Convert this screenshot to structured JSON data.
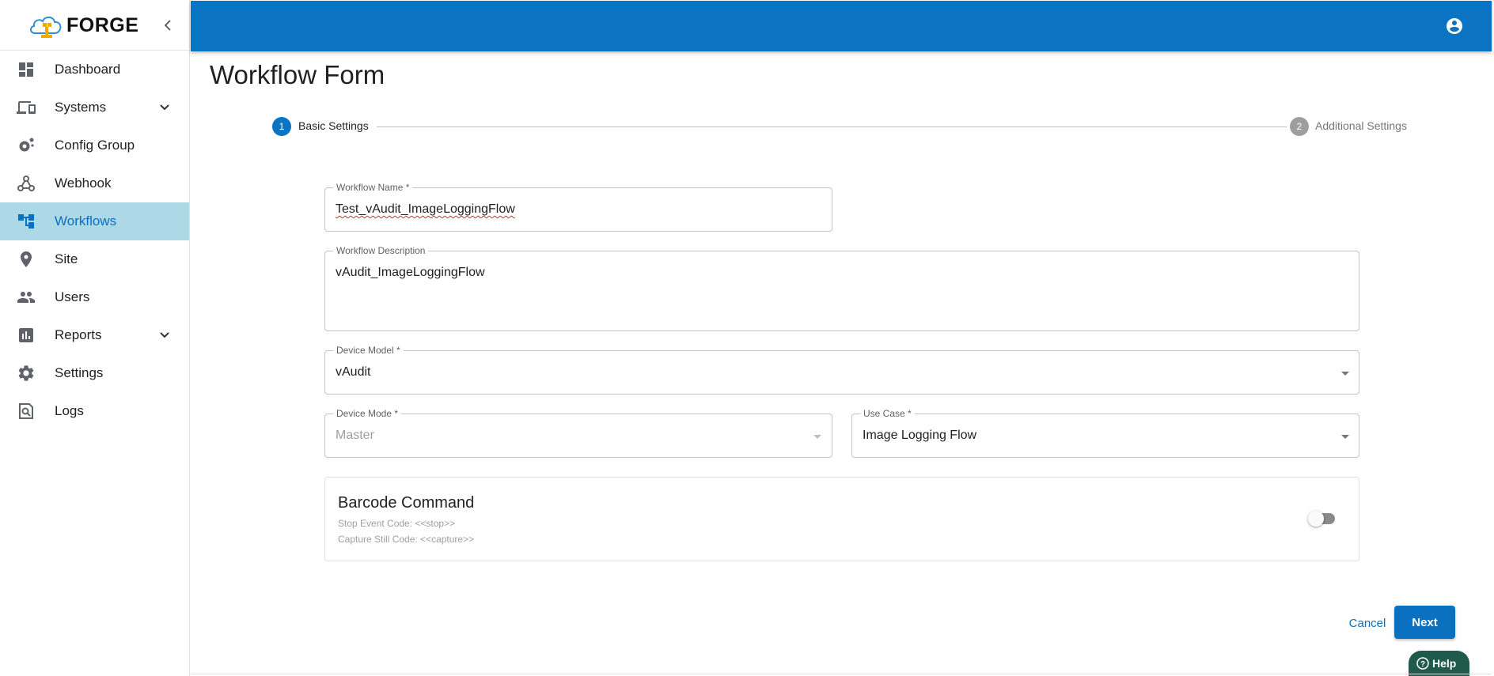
{
  "app": {
    "brand": "FORGE"
  },
  "sidebar": {
    "items": [
      {
        "label": "Dashboard",
        "icon": "dashboard-icon"
      },
      {
        "label": "Systems",
        "icon": "devices-icon",
        "expandable": true
      },
      {
        "label": "Config Group",
        "icon": "settings-gear-icon"
      },
      {
        "label": "Webhook",
        "icon": "webhook-icon"
      },
      {
        "label": "Workflows",
        "icon": "workflow-icon",
        "active": true
      },
      {
        "label": "Site",
        "icon": "location-pin-icon"
      },
      {
        "label": "Users",
        "icon": "users-icon"
      },
      {
        "label": "Reports",
        "icon": "bar-chart-icon",
        "expandable": true
      },
      {
        "label": "Settings",
        "icon": "gear-icon"
      },
      {
        "label": "Logs",
        "icon": "search-document-icon"
      }
    ]
  },
  "page": {
    "title": "Workflow Form"
  },
  "stepper": {
    "steps": [
      {
        "number": "1",
        "label": "Basic Settings",
        "active": true
      },
      {
        "number": "2",
        "label": "Additional Settings",
        "active": false
      }
    ]
  },
  "form": {
    "workflow_name": {
      "label": "Workflow Name *",
      "value": "Test_vAudit_ImageLoggingFlow"
    },
    "workflow_description": {
      "label": "Workflow Description",
      "value": "vAudit_ImageLoggingFlow"
    },
    "device_model": {
      "label": "Device Model *",
      "value": "vAudit"
    },
    "device_mode": {
      "label": "Device Mode *",
      "value": "Master",
      "disabled": true
    },
    "use_case": {
      "label": "Use Case *",
      "value": "Image Logging Flow"
    }
  },
  "barcode": {
    "title": "Barcode Command",
    "stop_event": "Stop Event Code: <<stop>>",
    "capture_still": "Capture Still Code: <<capture>>",
    "enabled": false
  },
  "actions": {
    "cancel": "Cancel",
    "next": "Next"
  },
  "help": {
    "label": "Help"
  },
  "colors": {
    "primary": "#0a73c2",
    "active_nav_bg": "#add8e6",
    "help_bg": "#1f5a4a"
  }
}
